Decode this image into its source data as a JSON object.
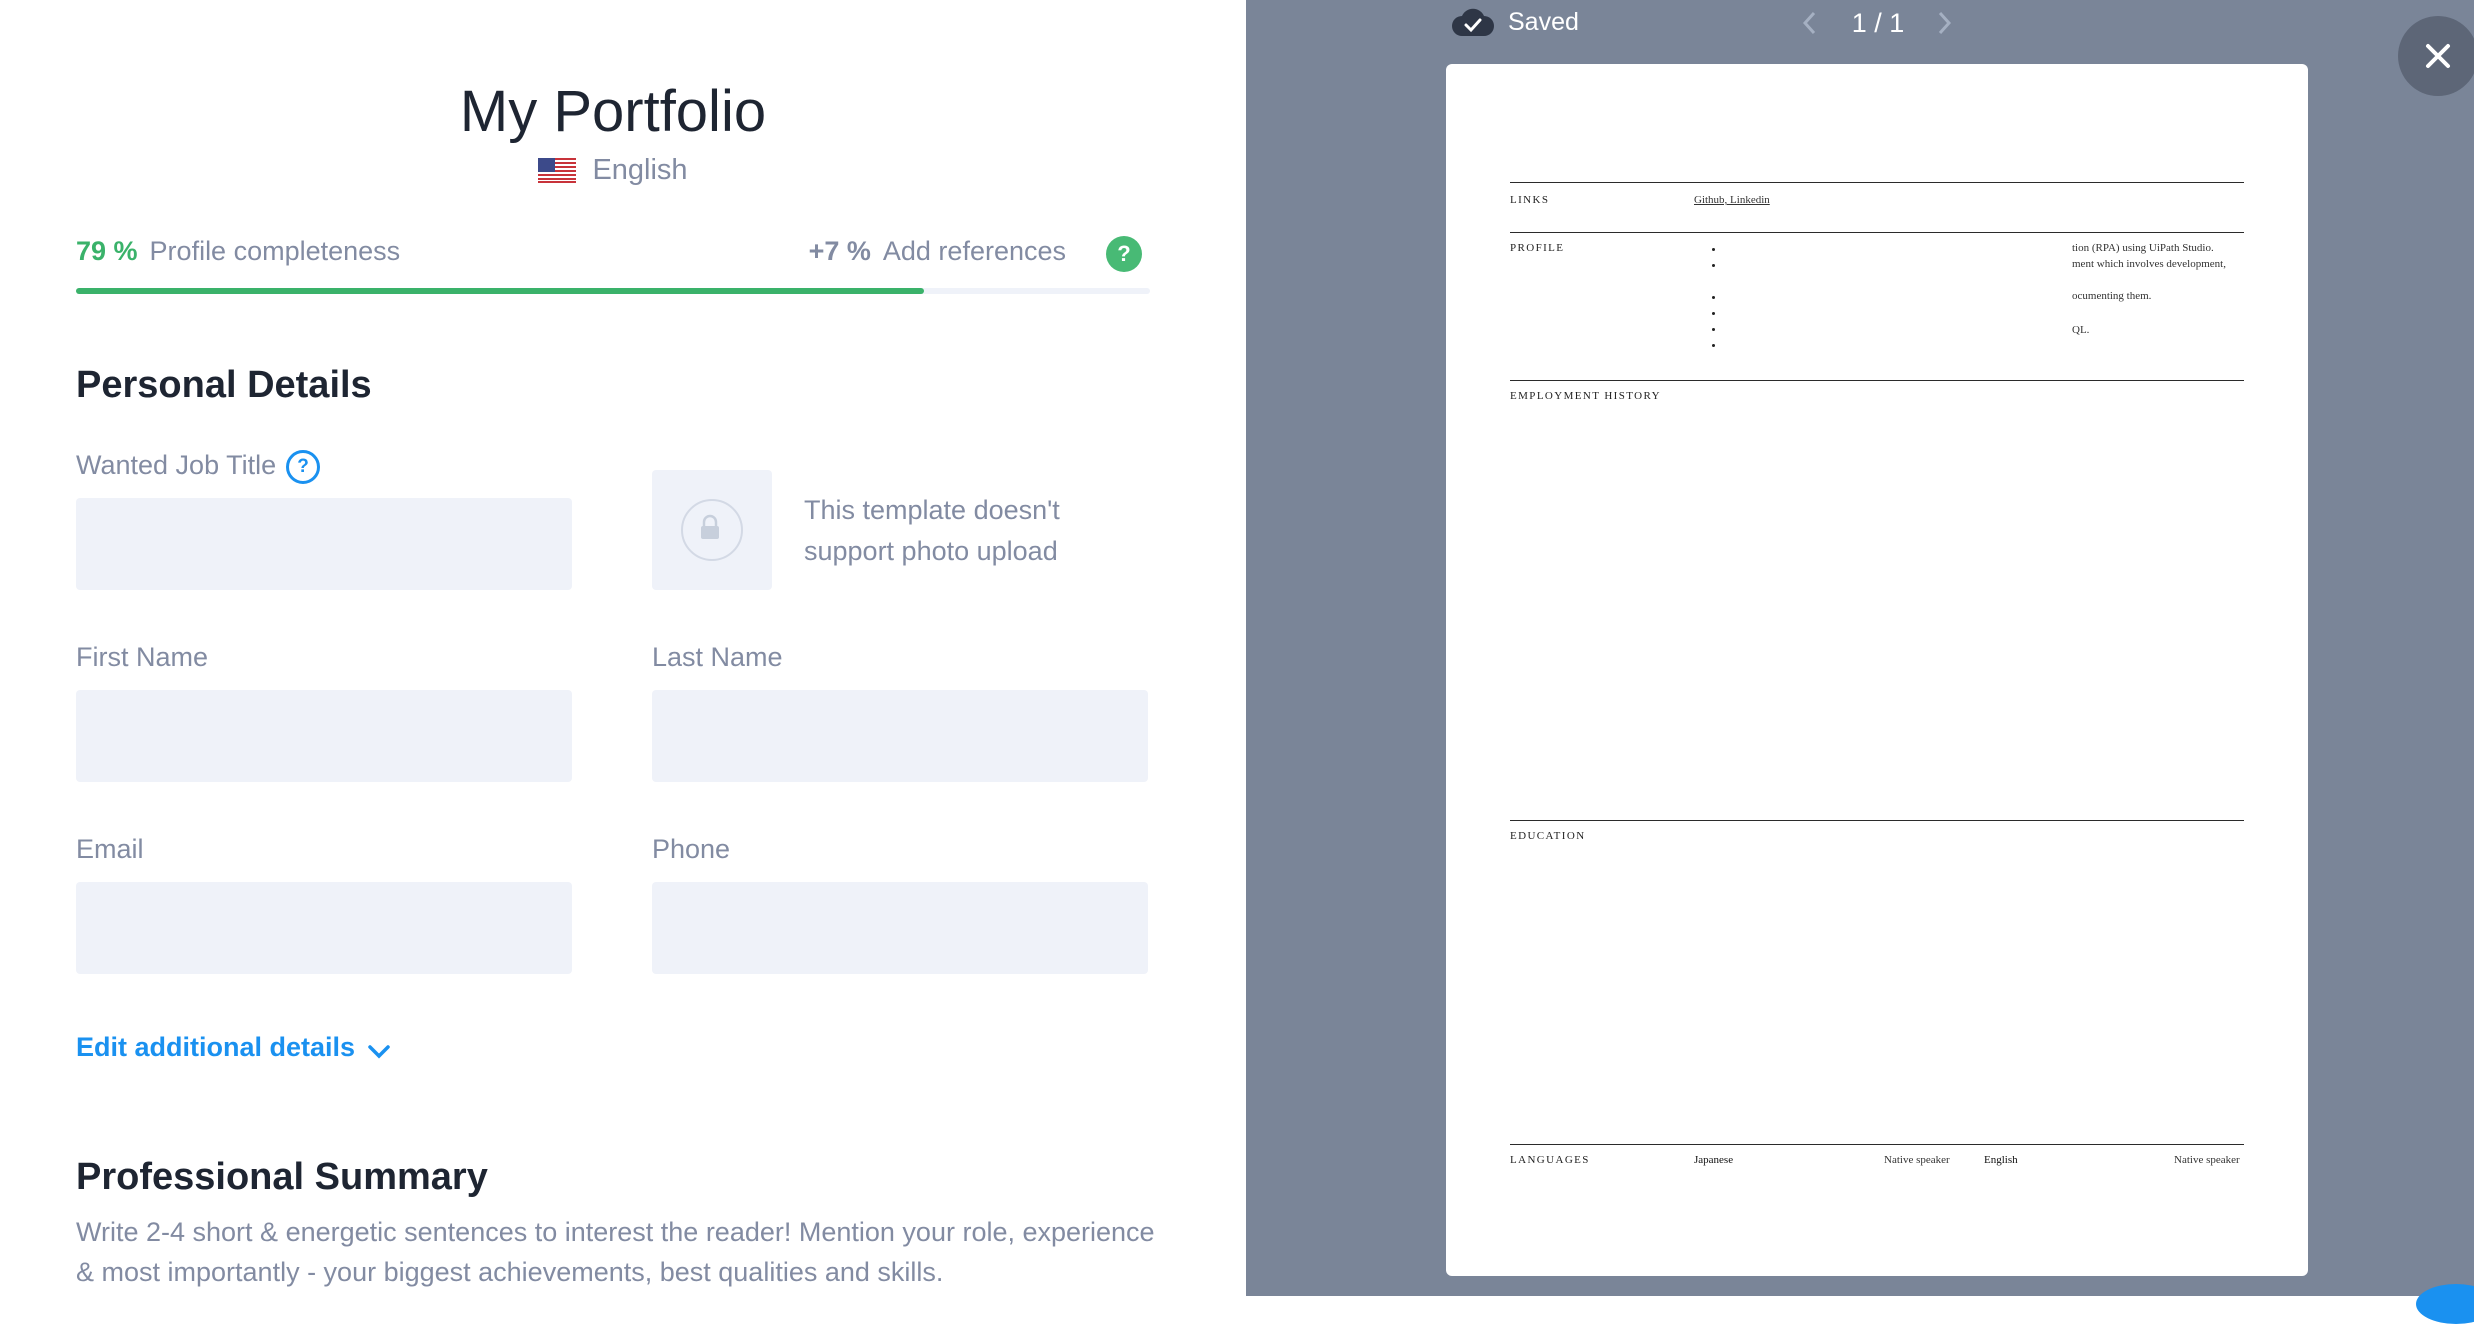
{
  "header": {
    "title": "My Portfolio",
    "language": "English"
  },
  "progress": {
    "percent_label": "79 %",
    "percent": 79,
    "label": "Profile completeness",
    "bonus_label": "+7 %",
    "bonus_text": "Add references",
    "help_icon": "?"
  },
  "personal": {
    "heading": "Personal Details",
    "job_title_label": "Wanted Job Title",
    "photo_text": "This template doesn't support photo upload",
    "first_name_label": "First Name",
    "last_name_label": "Last Name",
    "email_label": "Email",
    "phone_label": "Phone",
    "edit_additional": "Edit additional details"
  },
  "summary": {
    "heading": "Professional Summary",
    "description": "Write 2-4 short & energetic sentences to interest the reader! Mention your role, experience & most importantly - your biggest achievements, best qualities and skills."
  },
  "preview": {
    "saved_label": "Saved",
    "page_indicator": "1 / 1",
    "resume": {
      "links_label": "LINKS",
      "links_value": "Github, Linkedin",
      "profile_label": "PROFILE",
      "profile_lines": [
        "tion (RPA) using UiPath Studio.",
        "ment which involves development,",
        "ocumenting them.",
        "QL."
      ],
      "employment_label": "EMPLOYMENT HISTORY",
      "education_label": "EDUCATION",
      "languages_label": "LANGUAGES",
      "lang1": "Japanese",
      "lang1_level": "Native speaker",
      "lang2": "English",
      "lang2_level": "Native speaker"
    }
  },
  "colors": {
    "accent": "#1a91f0",
    "success": "#3ab26a",
    "muted": "#828ba2",
    "field_bg": "#eff2f9",
    "preview_bg": "#7a8598"
  }
}
